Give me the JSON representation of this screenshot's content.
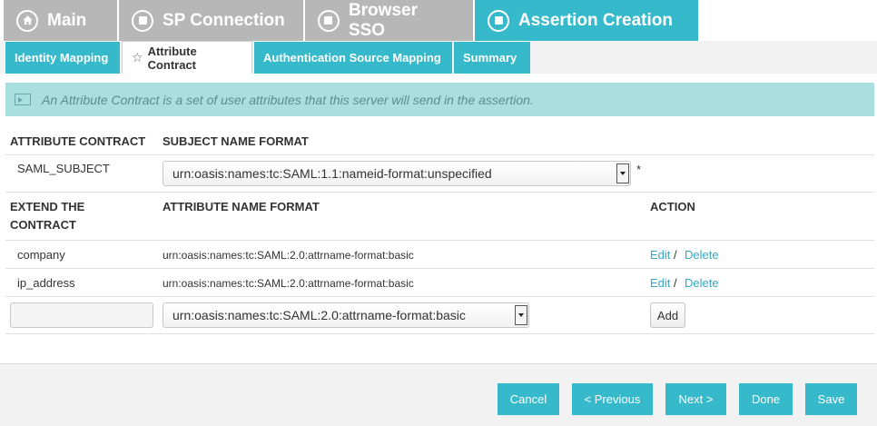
{
  "top_tabs": [
    {
      "label": "Main",
      "icon": "home-icon"
    },
    {
      "label": "SP Connection",
      "icon": "stop-circle-icon"
    },
    {
      "label": "Browser SSO",
      "icon": "stop-circle-icon"
    },
    {
      "label": "Assertion Creation",
      "icon": "stop-circle-icon",
      "active": true
    }
  ],
  "sub_tabs": [
    {
      "label": "Identity Mapping"
    },
    {
      "label": "Attribute Contract",
      "active": true
    },
    {
      "label": "Authentication Source Mapping"
    },
    {
      "label": "Summary"
    }
  ],
  "info": {
    "text": "An Attribute Contract is a set of user attributes that this server will send in the assertion."
  },
  "contract": {
    "header_attribute_contract": "ATTRIBUTE CONTRACT",
    "header_subject_name_format": "SUBJECT NAME FORMAT",
    "subject_name": "SAML_SUBJECT",
    "subject_format_value": "urn:oasis:names:tc:SAML:1.1:nameid-format:unspecified",
    "required_marker": "*"
  },
  "extend": {
    "header_extend_line1": "EXTEND THE",
    "header_extend_line2": "CONTRACT",
    "header_attribute_name_format": "ATTRIBUTE NAME FORMAT",
    "header_action": "ACTION",
    "rows": [
      {
        "name": "company",
        "format": "urn:oasis:names:tc:SAML:2.0:attrname-format:basic",
        "edit": "Edit",
        "separator": "/",
        "delete": "Delete"
      },
      {
        "name": "ip_address",
        "format": "urn:oasis:names:tc:SAML:2.0:attrname-format:basic",
        "edit": "Edit",
        "separator": "/",
        "delete": "Delete"
      }
    ],
    "new_row": {
      "name_value": "",
      "format_value": "urn:oasis:names:tc:SAML:2.0:attrname-format:basic",
      "add_label": "Add"
    }
  },
  "footer": {
    "cancel": "Cancel",
    "previous": "< Previous",
    "next": "Next >",
    "done": "Done",
    "save": "Save"
  },
  "colors": {
    "accent": "#36b9ca",
    "inactive_tab": "#b7b7b7",
    "info_bg": "#aadfdf",
    "link": "#36a8c4"
  }
}
